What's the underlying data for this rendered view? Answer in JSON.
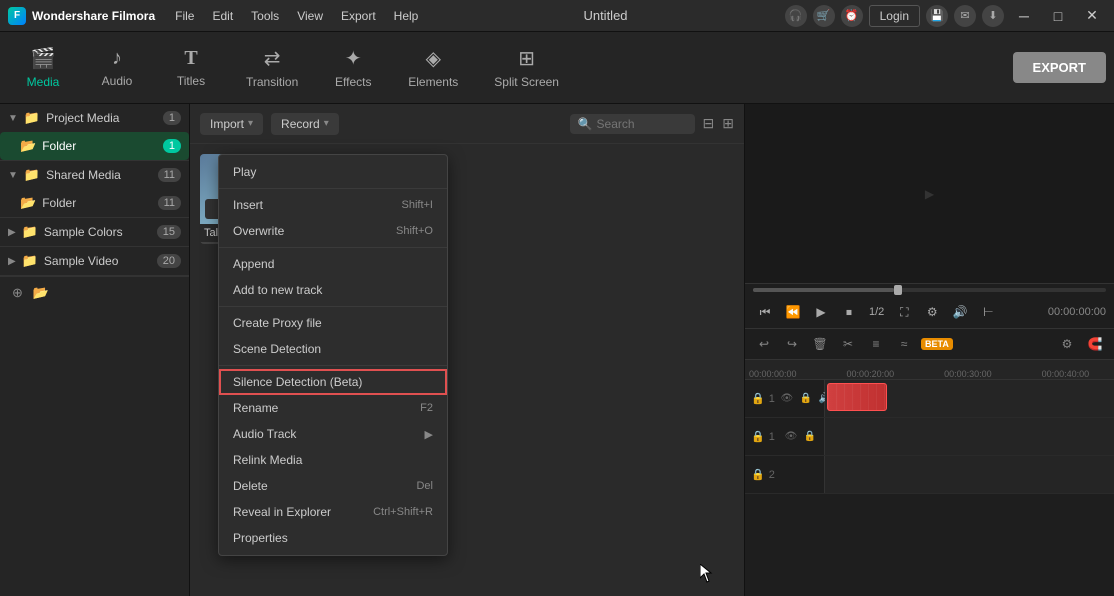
{
  "app": {
    "title": "Wondershare Filmora",
    "window_title": "Untitled"
  },
  "titlebar": {
    "logo_text": "Wondershare Filmora",
    "menus": [
      "File",
      "Edit",
      "Tools",
      "View",
      "Export",
      "Help"
    ],
    "login_label": "Login",
    "min_btn": "─",
    "max_btn": "□",
    "close_btn": "✕"
  },
  "toolbar": {
    "tabs": [
      {
        "id": "media",
        "label": "Media",
        "icon": "🎬",
        "active": true
      },
      {
        "id": "audio",
        "label": "Audio",
        "icon": "♪"
      },
      {
        "id": "titles",
        "label": "Titles",
        "icon": "T"
      },
      {
        "id": "transition",
        "label": "Transition",
        "icon": "↔"
      },
      {
        "id": "effects",
        "label": "Effects",
        "icon": "✦"
      },
      {
        "id": "elements",
        "label": "Elements",
        "icon": "◈"
      },
      {
        "id": "splitscreen",
        "label": "Split Screen",
        "icon": "⊞"
      }
    ],
    "export_label": "EXPORT"
  },
  "sidebar": {
    "sections": [
      {
        "id": "project-media",
        "label": "Project Media",
        "count": "1",
        "active": false,
        "items": [
          {
            "label": "Folder",
            "count": "1",
            "active": true,
            "highlighted": true
          }
        ]
      },
      {
        "id": "shared-media",
        "label": "Shared Media",
        "count": "11",
        "active": false,
        "items": [
          {
            "label": "Folder",
            "count": "11"
          }
        ]
      },
      {
        "id": "sample-colors",
        "label": "Sample Colors",
        "count": "15"
      },
      {
        "id": "sample-video",
        "label": "Sample Video",
        "count": "20"
      }
    ]
  },
  "media_toolbar": {
    "import_label": "Import",
    "record_label": "Record",
    "search_placeholder": "Search",
    "search_label": "Search"
  },
  "media_thumb": {
    "label": "Talking vide..."
  },
  "context_menu": {
    "items": [
      {
        "id": "play",
        "label": "Play",
        "shortcut": "",
        "has_arrow": false
      },
      {
        "id": "separator1",
        "type": "separator"
      },
      {
        "id": "insert",
        "label": "Insert",
        "shortcut": "Shift+I",
        "has_arrow": false
      },
      {
        "id": "overwrite",
        "label": "Overwrite",
        "shortcut": "Shift+O",
        "has_arrow": false
      },
      {
        "id": "separator2",
        "type": "separator"
      },
      {
        "id": "append",
        "label": "Append",
        "shortcut": "",
        "has_arrow": false
      },
      {
        "id": "add-to-new-track",
        "label": "Add to new track",
        "shortcut": "",
        "has_arrow": false
      },
      {
        "id": "separator3",
        "type": "separator"
      },
      {
        "id": "create-proxy",
        "label": "Create Proxy file",
        "shortcut": "",
        "has_arrow": false
      },
      {
        "id": "scene-detection",
        "label": "Scene Detection",
        "shortcut": "",
        "has_arrow": false
      },
      {
        "id": "separator4",
        "type": "separator"
      },
      {
        "id": "silence-detection",
        "label": "Silence Detection (Beta)",
        "shortcut": "",
        "has_arrow": false,
        "highlighted": true
      },
      {
        "id": "rename",
        "label": "Rename",
        "shortcut": "F2",
        "has_arrow": false
      },
      {
        "id": "audio-track",
        "label": "Audio Track",
        "shortcut": "",
        "has_arrow": true
      },
      {
        "id": "relink-media",
        "label": "Relink Media",
        "shortcut": "",
        "has_arrow": false
      },
      {
        "id": "delete",
        "label": "Delete",
        "shortcut": "Del",
        "has_arrow": false
      },
      {
        "id": "reveal-in-explorer",
        "label": "Reveal in Explorer",
        "shortcut": "Ctrl+Shift+R",
        "has_arrow": false
      },
      {
        "id": "properties",
        "label": "Properties",
        "shortcut": "",
        "has_arrow": false
      }
    ]
  },
  "player": {
    "timecode": "00:00:00:00",
    "speed": "1/2"
  },
  "timeline": {
    "track_controls": [
      "↩",
      "↪",
      "🗑",
      "✂",
      "≡",
      "≈"
    ],
    "beta_label": "BETA"
  }
}
